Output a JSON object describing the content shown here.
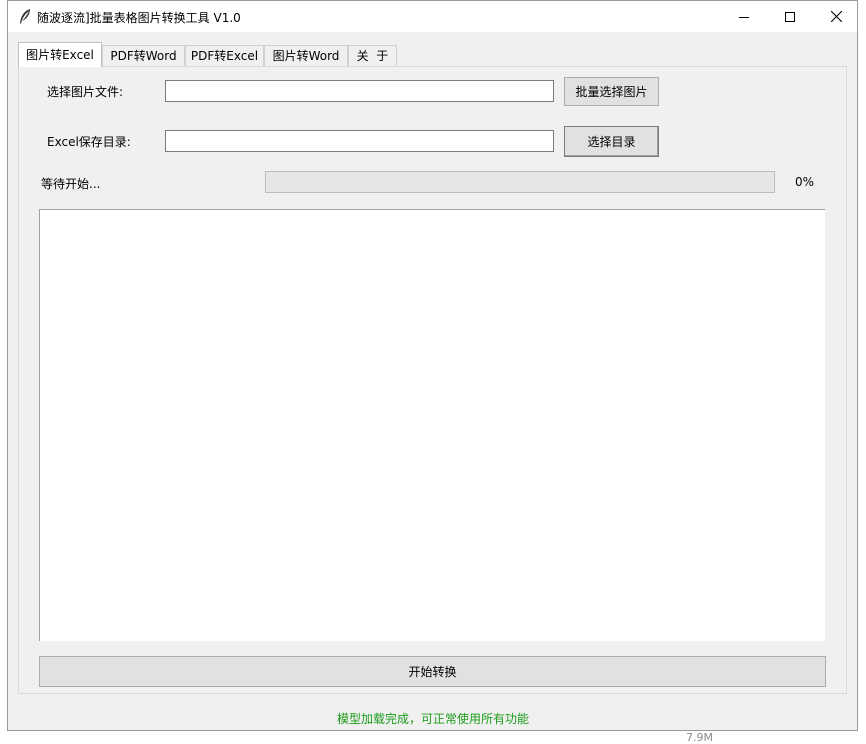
{
  "window": {
    "title": "随波逐流]批量表格图片转换工具 V1.0",
    "icon": "feather-icon",
    "controls": [
      "minimize-icon",
      "maximize-icon",
      "close-icon"
    ]
  },
  "tabs": [
    {
      "label": "图片转Excel",
      "active": true
    },
    {
      "label": "PDF转Word",
      "active": false
    },
    {
      "label": "PDF转Excel",
      "active": false
    },
    {
      "label": "图片转Word",
      "active": false
    },
    {
      "label": "关  于",
      "active": false
    }
  ],
  "form": {
    "image_label": "选择图片文件:",
    "image_value": "",
    "image_button": "批量选择图片",
    "dir_label": "Excel保存目录:",
    "dir_value": "",
    "dir_button": "选择目录"
  },
  "progress": {
    "status": "等待开始...",
    "value": 0,
    "percent_text": "0%"
  },
  "log": {
    "text": ""
  },
  "start_button": "开始转换",
  "status_bar": {
    "text": "模型加载完成，可正常使用所有功能",
    "color": "#1a9c1a"
  },
  "background_text": "7.9M"
}
